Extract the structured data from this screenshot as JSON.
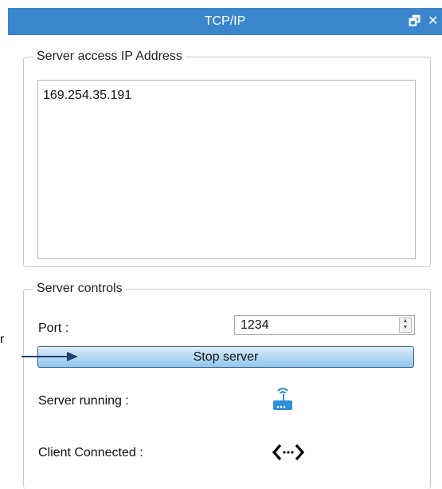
{
  "window": {
    "title": "TCP/IP",
    "restore_glyph": "🗗",
    "close_glyph": "✕"
  },
  "server_access": {
    "legend": "Server access IP Address",
    "ip_list": [
      "169.254.35.191"
    ]
  },
  "server_controls": {
    "legend": "Server controls",
    "port_label": "Port :",
    "port_value": "1234",
    "stop_button": "Stop server",
    "server_running_label": "Server running :",
    "server_running_icon": "router-icon",
    "client_connected_label": "Client Connected :",
    "client_connected_icon": "connection-arrows-icon"
  },
  "annotation": {
    "letter": "r"
  },
  "colors": {
    "titlebar": "#3a86cc",
    "button_top": "#d9ecfa",
    "button_bottom": "#93c6ef",
    "arrow": "#1f3f6e",
    "router": "#2f8fd9"
  }
}
